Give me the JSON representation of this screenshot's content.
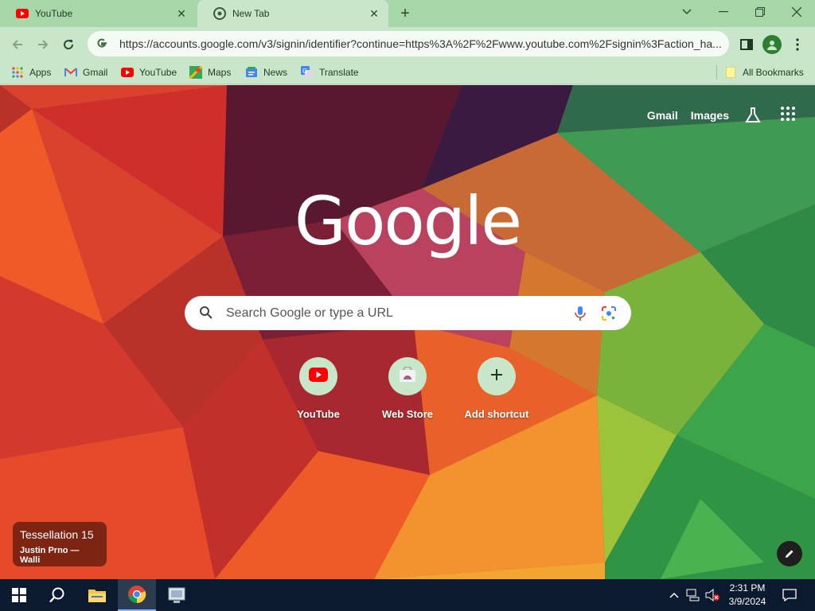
{
  "browser": {
    "tabs": [
      {
        "title": "YouTube",
        "favicon": "youtube-icon",
        "active": false
      },
      {
        "title": "New Tab",
        "favicon": "chrome-icon",
        "active": true
      }
    ],
    "new_tab_symbol": "+",
    "address_bar": {
      "url": "https://accounts.google.com/v3/signin/identifier?continue=https%3A%2F%2Fwww.youtube.com%2Fsignin%3Faction_ha..."
    },
    "bookmarks": [
      {
        "label": "Apps",
        "icon": "apps-grid-icon"
      },
      {
        "label": "Gmail",
        "icon": "gmail-icon"
      },
      {
        "label": "YouTube",
        "icon": "youtube-icon"
      },
      {
        "label": "Maps",
        "icon": "maps-icon"
      },
      {
        "label": "News",
        "icon": "news-icon"
      },
      {
        "label": "Translate",
        "icon": "translate-icon"
      }
    ],
    "all_bookmarks_label": "All Bookmarks",
    "theme_color": "#c8e6c9"
  },
  "newtab": {
    "top_links": {
      "gmail": "Gmail",
      "images": "Images"
    },
    "logo": "Google",
    "search_placeholder": "Search Google or type a URL",
    "shortcuts": [
      {
        "label": "YouTube",
        "icon": "youtube-icon"
      },
      {
        "label": "Web Store",
        "icon": "web-store-icon"
      },
      {
        "label": "Add shortcut",
        "icon": "plus-icon"
      }
    ],
    "attribution": {
      "title": "Tessellation 15",
      "author": "Justin Prno — Walli"
    }
  },
  "taskbar": {
    "clock": {
      "time": "2:31 PM",
      "date": "3/9/2024"
    },
    "apps": [
      "windows-start-icon",
      "search-icon",
      "file-explorer-icon",
      "chrome-icon",
      "app-icon"
    ]
  }
}
